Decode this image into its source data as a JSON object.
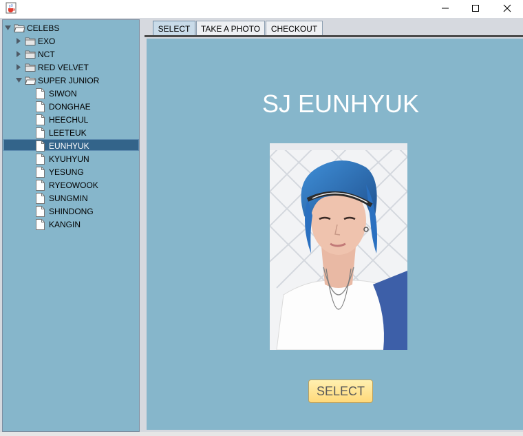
{
  "window": {
    "icons": {
      "app": "java-cup-icon",
      "minimize": "minimize-icon",
      "maximize": "maximize-icon",
      "close": "close-icon"
    }
  },
  "tree": {
    "root": {
      "label": "CELEBS",
      "expanded": true
    },
    "groups": [
      {
        "label": "EXO",
        "expanded": false
      },
      {
        "label": "NCT",
        "expanded": false
      },
      {
        "label": "RED VELVET",
        "expanded": false
      },
      {
        "label": "SUPER JUNIOR",
        "expanded": true
      }
    ],
    "members": [
      "SIWON",
      "DONGHAE",
      "HEECHUL",
      "LEETEUK",
      "EUNHYUK",
      "KYUHYUN",
      "YESUNG",
      "RYEOWOOK",
      "SUNGMIN",
      "SHINDONG",
      "KANGIN"
    ],
    "selected": "EUNHYUK"
  },
  "tabs": [
    {
      "label": "SELECT",
      "active": true
    },
    {
      "label": "TAKE A PHOTO",
      "active": false
    },
    {
      "label": "CHECKOUT",
      "active": false
    }
  ],
  "main": {
    "celeb_name": "SJ EUNHYUK",
    "select_label": "SELECT"
  },
  "colors": {
    "panel": "#86b6cb",
    "selection": "#33648a",
    "button": "#ffd97a",
    "title_text": "#ffffff"
  }
}
